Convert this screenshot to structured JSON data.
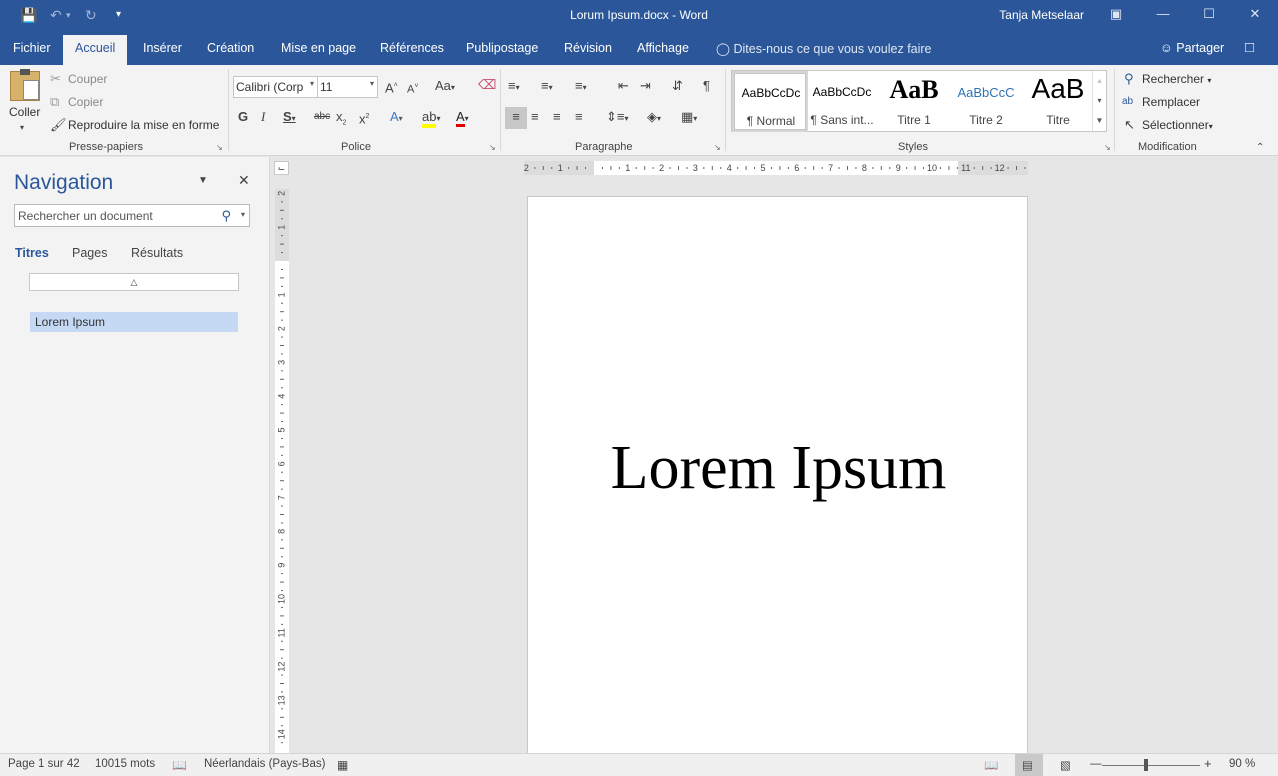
{
  "window": {
    "title": "Lorum Ipsum.docx  -  Word",
    "user": "Tanja Metselaar"
  },
  "tabs": [
    "Fichier",
    "Accueil",
    "Insérer",
    "Création",
    "Mise en page",
    "Références",
    "Publipostage",
    "Révision",
    "Affichage"
  ],
  "tell_me": "Dites-nous ce que vous voulez faire",
  "share": "Partager",
  "clipboard": {
    "paste": "Coller",
    "cut": "Couper",
    "copy": "Copier",
    "format_painter": "Reproduire la mise en forme",
    "group": "Presse-papiers"
  },
  "font": {
    "name": "Calibri (Corp",
    "size": "11",
    "group": "Police"
  },
  "paragraph": {
    "group": "Paragraphe"
  },
  "styles": {
    "group": "Styles",
    "items": [
      {
        "preview": "AaBbCcDc",
        "name": "¶ Normal"
      },
      {
        "preview": "AaBbCcDc",
        "name": "¶ Sans int..."
      },
      {
        "preview": "AaB",
        "name": "Titre 1"
      },
      {
        "preview": "AaBbCcC",
        "name": "Titre 2"
      },
      {
        "preview": "AaB",
        "name": "Titre"
      }
    ]
  },
  "editing": {
    "group": "Modification",
    "find": "Rechercher",
    "replace": "Remplacer",
    "select": "Sélectionner"
  },
  "navigation": {
    "title": "Navigation",
    "search_placeholder": "Rechercher un document",
    "tabs": [
      "Titres",
      "Pages",
      "Résultats"
    ],
    "headings": [
      "Lorem Ipsum"
    ]
  },
  "ruler": {
    "horizontal_labels": [
      "2",
      "1",
      "1",
      "2",
      "3",
      "4",
      "5",
      "6",
      "7",
      "8",
      "9",
      "10",
      "11",
      "12"
    ],
    "vertical_labels": [
      "2",
      "1",
      "1",
      "2",
      "3",
      "4",
      "5",
      "6",
      "7",
      "8",
      "9",
      "10",
      "11",
      "12",
      "13",
      "14"
    ]
  },
  "document": {
    "heading": "Lorem Ipsum"
  },
  "status": {
    "page": "Page 1 sur 42",
    "words": "10015 mots",
    "language": "Néerlandais (Pays-Bas)",
    "zoom": "90 %"
  },
  "colors": {
    "accent": "#2b579a",
    "ribbon": "#f3f3f3",
    "nav_selected": "#c6d9f4"
  }
}
